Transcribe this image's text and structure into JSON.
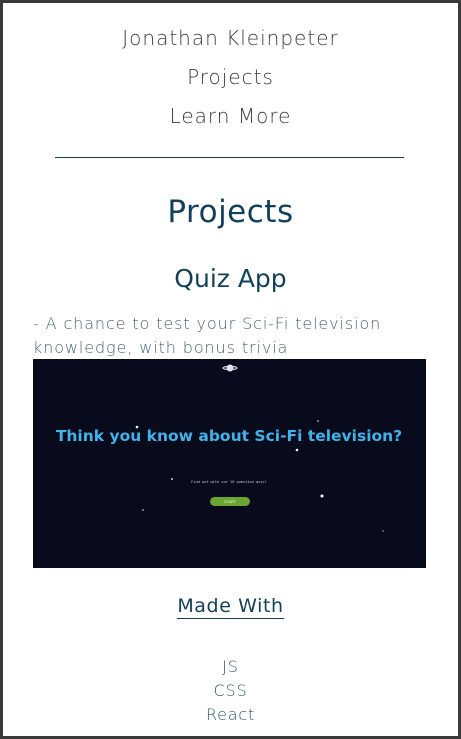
{
  "nav": {
    "name": "Jonathan Kleinpeter",
    "projects": "Projects",
    "learn_more": "Learn More"
  },
  "page": {
    "title": "Projects"
  },
  "project": {
    "title": "Quiz App",
    "description": "- A chance to test your Sci-Fi television knowledge, with bonus trivia",
    "preview": {
      "headline": "Think you know about Sci-Fi television?",
      "subtext": "Find out with our 10 question quiz!",
      "button_label": "START",
      "background_color": "#070b1c",
      "headline_color": "#3fb3ea",
      "button_color": "#6aa532"
    },
    "made_with_label": "Made With",
    "technologies": [
      "JS",
      "CSS",
      "React"
    ]
  },
  "colors": {
    "accent": "#123f5a",
    "nav_text": "#3d3d3d"
  }
}
